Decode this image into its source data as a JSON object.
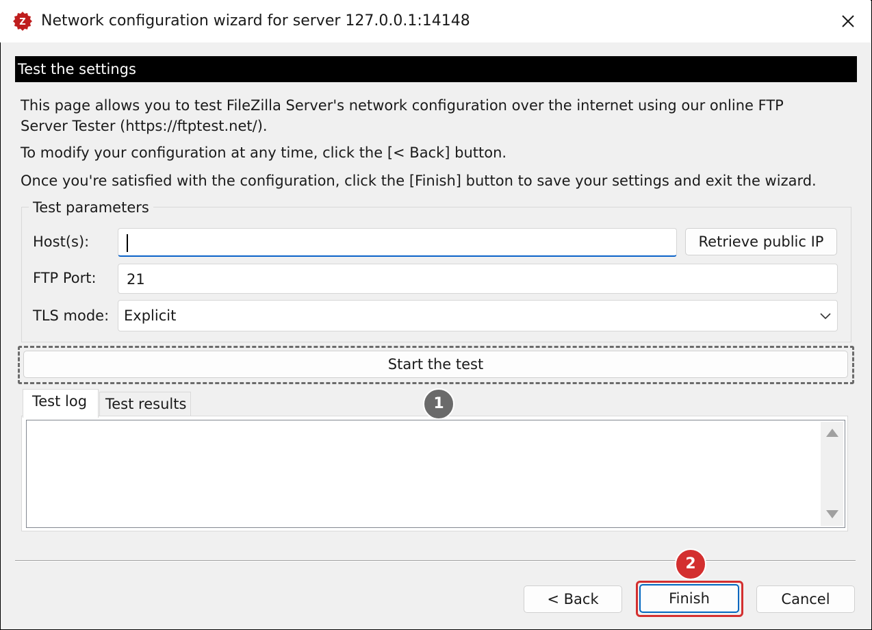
{
  "window": {
    "title": "Network configuration wizard for server 127.0.0.1:14148",
    "app_icon": "filezilla-server-icon",
    "close_icon": "close-icon"
  },
  "section": {
    "title": "Test the settings"
  },
  "description": {
    "line1": "This page allows you to test FileZilla Server's network configuration over the internet using our online FTP",
    "line2": "Server Tester (https://ftptest.net/).",
    "line3": "To modify your configuration at any time, click the [< Back] button.",
    "line4": "Once you're satisfied with the configuration, click the [Finish] button to save your settings and exit the wizard."
  },
  "test_parameters": {
    "legend": "Test parameters",
    "host_label": "Host(s):",
    "host_value": "",
    "retrieve_button": "Retrieve public IP",
    "port_label": "FTP Port:",
    "port_value": "21",
    "tls_label": "TLS mode:",
    "tls_value": "Explicit"
  },
  "start_button": "Start the test",
  "tabs": [
    {
      "label": "Test log",
      "active": true
    },
    {
      "label": "Test results",
      "active": false
    }
  ],
  "log_text": "",
  "badges": {
    "one": "1",
    "two": "2"
  },
  "buttons": {
    "back": "< Back",
    "finish": "Finish",
    "cancel": "Cancel"
  },
  "colors": {
    "highlight_red": "#d32f2f",
    "badge_gray": "#6a6a6a",
    "focus_blue": "#0b63c9",
    "section_bar": "#000000"
  }
}
